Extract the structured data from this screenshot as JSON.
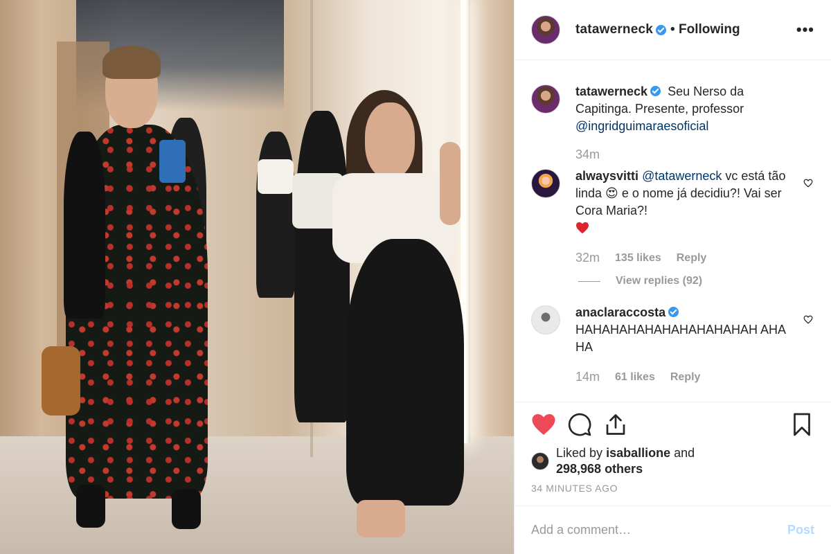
{
  "post": {
    "author": "tatawerneck",
    "following_label": "• Following",
    "more_label": "•••",
    "photo_alt": "Two women posing in a mirrored elevator hallway"
  },
  "caption": {
    "author": "tatawerneck",
    "text": "Seu Nerso da Capitinga. Presente, professor",
    "mention": "@ingridguimaraesoficial",
    "time": "34m"
  },
  "comments": [
    {
      "author": "alwaysvitti",
      "mention": "@tatawerneck",
      "text_before_emoji": "vc está tão linda",
      "emoji": "😍",
      "text_after_emoji": "e o nome já decidiu?! Vai ser Cora Maria?!",
      "time": "32m",
      "likes": "135 likes",
      "reply": "Reply",
      "view_replies": "View replies (92)"
    },
    {
      "author": "anaclaraccosta",
      "text": "HAHAHAHAHAHAHAHAHAHAH AHAHA",
      "time": "14m",
      "likes": "61 likes",
      "reply": "Reply"
    }
  ],
  "likes": {
    "prefix": "Liked by",
    "user": "isaballione",
    "and": "and",
    "others": "298,968 others"
  },
  "timestamp": "34 MINUTES AGO",
  "composer": {
    "placeholder": "Add a comment…",
    "post_label": "Post"
  },
  "colors": {
    "like_red": "#ed4956",
    "link_blue": "#003569",
    "verified_blue": "#3897f0",
    "post_disabled": "#b3dbff"
  },
  "icons": [
    "more-icon",
    "verified-icon",
    "heart-filled-icon",
    "comment-icon",
    "share-icon",
    "bookmark-icon",
    "heart-outline-icon",
    "heart-emoji-icon"
  ]
}
